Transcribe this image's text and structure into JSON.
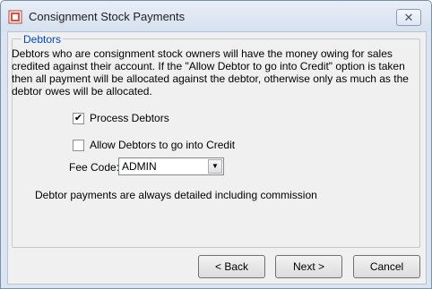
{
  "window": {
    "title": "Consignment Stock Payments",
    "close_glyph": "✕"
  },
  "group": {
    "legend": "Debtors",
    "description": "Debtors who are consignment stock owners will have the money owing for sales credited against their account.  If the \"Allow Debtor to go into Credit\" option is taken then all payment will be allocated against the debtor, otherwise only as much as the debtor owes will be allocated.",
    "process_debtors": {
      "label": "Process Debtors",
      "checked": true,
      "mark": "✔"
    },
    "allow_credit": {
      "label": "Allow Debtors to go into Credit",
      "checked": false
    },
    "fee_code": {
      "label": "Fee Code:",
      "value": "ADMIN",
      "arrow": "▼"
    },
    "note": "Debtor payments are always detailed including commission"
  },
  "buttons": {
    "back": "< Back",
    "next": "Next >",
    "cancel": "Cancel"
  },
  "icons": {
    "app": "app-icon",
    "close": "close-icon",
    "dropdown": "chevron-down-icon",
    "check": "check-icon"
  }
}
